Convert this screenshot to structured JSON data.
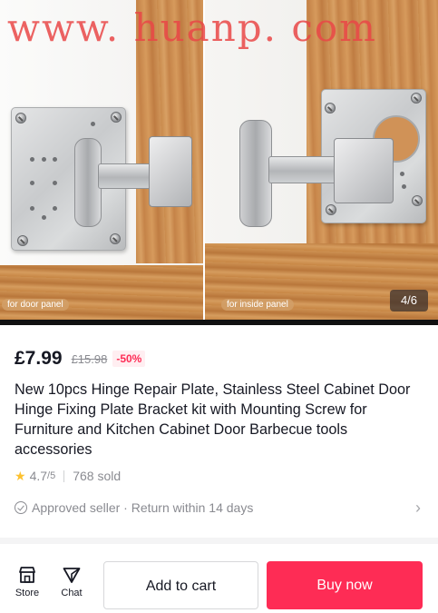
{
  "watermark": "www. huanp. com",
  "gallery": {
    "left_tag": "for door panel",
    "right_tag": "for inside panel",
    "counter": "4/6"
  },
  "product": {
    "price": "£7.99",
    "original_price": "£15.98",
    "discount": "-50%",
    "title": "New 10pcs Hinge Repair Plate, Stainless Steel Cabinet Door Hinge Fixing Plate Bracket kit with Mounting Screw for Furniture and Kitchen Cabinet Door Barbecue tools accessories",
    "rating": "4.7",
    "rating_scale": "/5",
    "sold": "768 sold",
    "seller_info": "Approved seller · Return within 14 days"
  },
  "bottom_bar": {
    "store_label": "Store",
    "chat_label": "Chat",
    "add_to_cart": "Add to cart",
    "buy_now": "Buy now"
  },
  "colors": {
    "accent": "#fe2c55",
    "star": "#fdc12f",
    "muted_text": "#8a8b91"
  },
  "icons": [
    "star-icon",
    "check-circle-icon",
    "chevron-right-icon",
    "store-icon",
    "chat-icon"
  ]
}
